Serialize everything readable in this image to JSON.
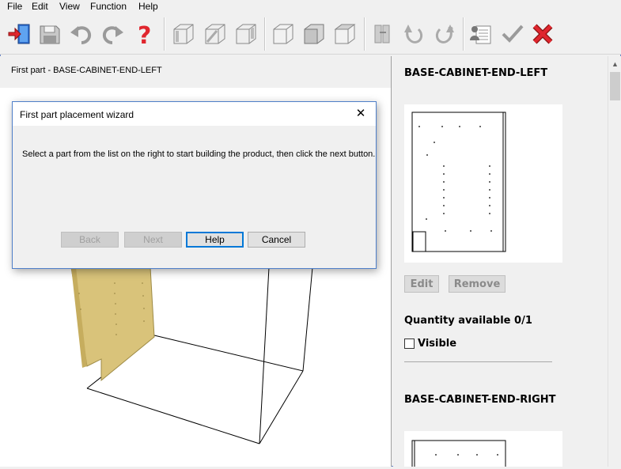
{
  "menu": {
    "file": "File",
    "edit": "Edit",
    "view": "View",
    "function": "Function",
    "help": "Help"
  },
  "toolbar": {
    "icons": [
      "exit-icon",
      "save-icon",
      "undo-icon",
      "redo-icon",
      "help-icon",
      "view-left-icon",
      "view-front-icon",
      "view-right-icon",
      "iso-icon",
      "box-front-icon",
      "box-top-icon",
      "part-icon",
      "rotate-icon",
      "rotate-r-icon",
      "parts-list-icon",
      "checkmark-icon",
      "cancel-x-icon"
    ]
  },
  "left": {
    "header": "First part - BASE-CABINET-END-LEFT"
  },
  "dialog": {
    "title": "First part placement wizard",
    "close": "✕",
    "message": "Select a part from the list on the right to start building the product, then click the next button.",
    "buttons": {
      "back": "Back",
      "next": "Next",
      "help": "Help",
      "cancel": "Cancel"
    }
  },
  "right": {
    "part1": {
      "name": "BASE-CABINET-END-LEFT",
      "edit": "Edit",
      "remove": "Remove",
      "quantity": "Quantity available 0/1",
      "visible_label": "Visible",
      "visible_checked": false
    },
    "part2": {
      "name": "BASE-CABINET-END-RIGHT"
    }
  },
  "colors": {
    "panel": "#d9c37a",
    "accent": "#0078d7"
  }
}
